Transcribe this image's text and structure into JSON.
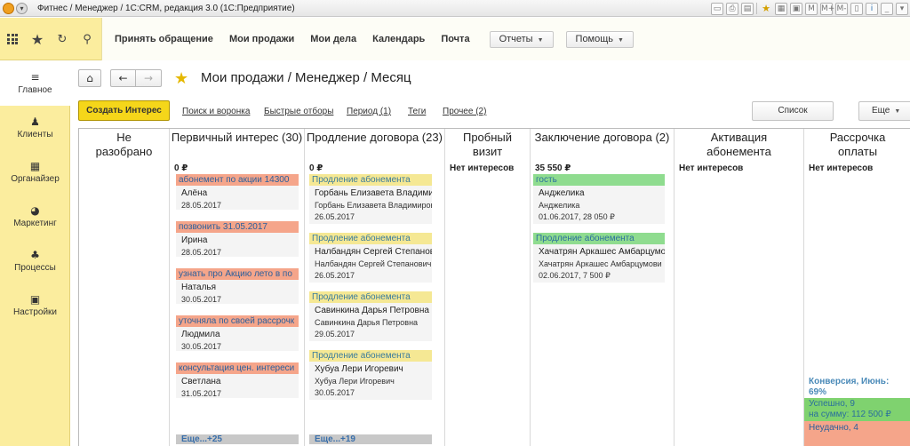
{
  "window": {
    "title": "Фитнес / Менеджер / 1С:CRM, редакция 3.0  (1С:Предприятие)",
    "titlebar_icons": [
      "save-icon",
      "print-icon",
      "preview-icon",
      "favorite-icon",
      "calendar-icon",
      "calculator-icon",
      "memory-m-icon",
      "memory-m-plus-icon",
      "memory-m-minus-icon",
      "split-window-icon",
      "info-icon",
      "minimize-icon",
      "dropdown-icon"
    ],
    "titlebar_glyphs": [
      "▭",
      "⎙",
      "▤",
      "★",
      "▦",
      "▣",
      "M",
      "M+",
      "M-",
      "▯",
      "i",
      "_",
      "▾"
    ]
  },
  "toolbar": {
    "icons": [
      "apps-grid-icon",
      "favorites-star-icon",
      "history-icon",
      "search-icon"
    ],
    "nav": [
      "Принять обращение",
      "Мои продажи",
      "Мои дела",
      "Календарь",
      "Почта"
    ],
    "dropdowns": [
      "Отчеты",
      "Помощь"
    ]
  },
  "sidebar": {
    "items": [
      {
        "label": "Главное",
        "icon": "menu-lines-icon",
        "glyph": "≡",
        "active": true
      },
      {
        "label": "Клиенты",
        "icon": "clients-icon",
        "glyph": "♟",
        "active": false
      },
      {
        "label": "Органайзер",
        "icon": "organizer-calendar-icon",
        "glyph": "▦",
        "active": false
      },
      {
        "label": "Маркетинг",
        "icon": "marketing-icon",
        "glyph": "◕",
        "active": false
      },
      {
        "label": "Процессы",
        "icon": "processes-icon",
        "glyph": "♣",
        "active": false
      },
      {
        "label": "Настройки",
        "icon": "settings-icon",
        "glyph": "▣",
        "active": false
      }
    ]
  },
  "page": {
    "home_glyph": "⌂",
    "back_glyph": "←",
    "forward_glyph": "→",
    "star_glyph": "★",
    "title": "Мои продажи / Менеджер / Месяц"
  },
  "commands": {
    "create": "Создать Интерес",
    "links": [
      "Поиск и воронка",
      "Быстрые отборы",
      "Период (1)",
      "Теги",
      "Прочее (2)"
    ],
    "list_button": "Список",
    "more_button": "Еще"
  },
  "board": {
    "columns": [
      {
        "title": "Не разобрано",
        "sum": "",
        "note": ""
      },
      {
        "title": "Первичный интерес (30)",
        "sum": "0 ₽",
        "note": ""
      },
      {
        "title": "Продление договора (23)",
        "sum": "0 ₽",
        "note": ""
      },
      {
        "title": "Пробный визит",
        "sum": "",
        "note": "Нет интересов"
      },
      {
        "title": "Заключение договора (2)",
        "sum": "35 550 ₽",
        "note": ""
      },
      {
        "title": "Активация абонемента",
        "sum": "",
        "note": "Нет интересов"
      },
      {
        "title": "Рассрочка оплаты",
        "sum": "",
        "note": "Нет интересов"
      }
    ],
    "cards_primary": [
      {
        "tag": "абонемент по акции 14300",
        "name": "Алёна",
        "date": "28.05.2017"
      },
      {
        "tag": "позвонить 31.05.2017",
        "name": "Ирина",
        "date": "28.05.2017"
      },
      {
        "tag": "узнать про Акцию лето в по",
        "name": "Наталья",
        "date": "30.05.2017"
      },
      {
        "tag": "уточняла по своей рассрочк",
        "name": "Людмила",
        "date": "30.05.2017"
      },
      {
        "tag": "консультация цен. интереси",
        "name": "Светлана",
        "date": "31.05.2017"
      }
    ],
    "more_primary": "Еще...+25",
    "cards_renewal": [
      {
        "tag": "Продление абонемента",
        "name": "Горбань Елизавета Владимир",
        "contact": "Горбань Елизавета Владимировна",
        "date": "26.05.2017"
      },
      {
        "tag": "Продление абонемента",
        "name": "Налбандян Сергей Степанович",
        "contact": "Налбандян Сергей Степанович",
        "date": "26.05.2017"
      },
      {
        "tag": "Продление абонемента",
        "name": "Савинкина Дарья Петровна",
        "contact": "Савинкина Дарья Петровна",
        "date": "29.05.2017"
      },
      {
        "tag": "Продление абонемента",
        "name": "Хубуа Лери Игоревич",
        "contact": "Хубуа Лери Игоревич",
        "date": "30.05.2017"
      }
    ],
    "more_renewal": "Еще...+19",
    "cards_contract": [
      {
        "tag": "гость",
        "name": "Анджелика",
        "contact": "Анджелика",
        "date": "01.06.2017, 28 050 ₽"
      },
      {
        "tag": "Продление абонемента",
        "name": "Хачатрян Аркашес Амбарцумо",
        "contact": "Хачатрян Аркашес Амбарцумови",
        "date": "02.06.2017, 7 500 ₽"
      }
    ],
    "stats": {
      "conversion_line1": "Конверсия, Июнь:",
      "conversion_line2": "69%",
      "success_line1": "Успешно, 9",
      "success_line2": "на сумму: 112 500 ₽",
      "fail": "Неудачно, 4"
    }
  }
}
